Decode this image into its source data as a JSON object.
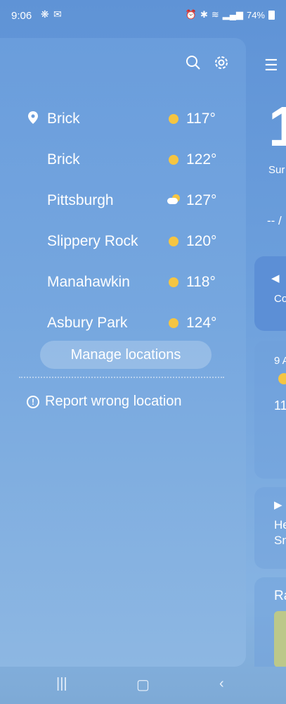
{
  "status": {
    "time": "9:06",
    "battery": "74%"
  },
  "drawer": {
    "search_icon": "search-icon",
    "settings_icon": "gear-icon",
    "locations": [
      {
        "name": "Brick",
        "temp": "117°",
        "icon": "sun-icon",
        "current": true
      },
      {
        "name": "Brick",
        "temp": "122°",
        "icon": "sun-icon"
      },
      {
        "name": "Pittsburgh",
        "temp": "127°",
        "icon": "partly-cloudy-icon"
      },
      {
        "name": "Slippery Rock",
        "temp": "120°",
        "icon": "sun-icon"
      },
      {
        "name": "Manahawkin",
        "temp": "118°",
        "icon": "sun-icon"
      },
      {
        "name": "Asbury Park",
        "temp": "124°",
        "icon": "sun-icon"
      }
    ],
    "manage_label": "Manage locations",
    "report_label": "Report wrong location"
  },
  "peek": {
    "big_temp": "1",
    "sun_text": "Sur",
    "dash_text": "-- /",
    "card1_text": "Co",
    "card2_hour": "9 A",
    "card2_temp": "11",
    "card3_text1": "He",
    "card3_text2": "Sn",
    "card4_text": "Ra"
  },
  "colors": {
    "background": "#6a9ddc",
    "sun": "#f5c542"
  }
}
